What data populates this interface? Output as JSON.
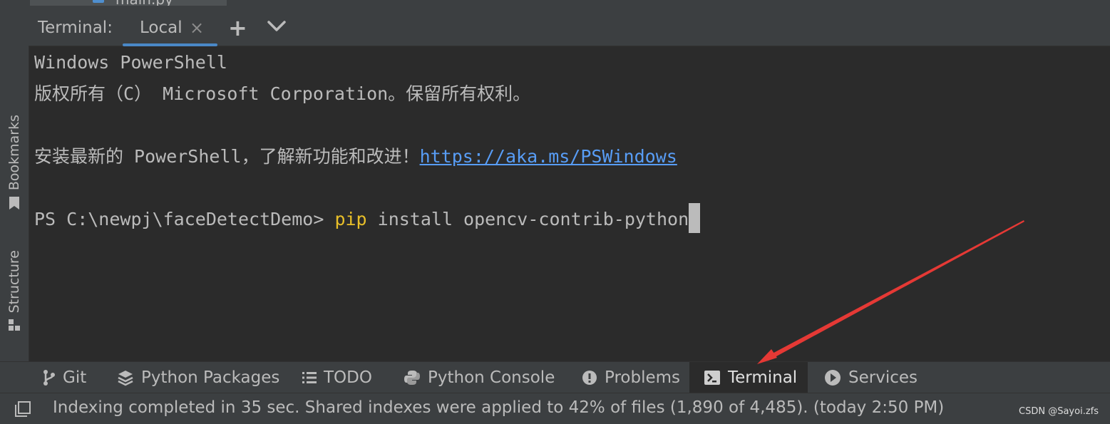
{
  "editor": {
    "file_tab": "main.py"
  },
  "side_tabs": [
    {
      "label": "Bookmarks",
      "icon": "bookmark-icon"
    },
    {
      "label": "Structure",
      "icon": "structure-icon"
    }
  ],
  "terminal": {
    "title": "Terminal:",
    "tab_label": "Local",
    "close_glyph": "×",
    "new_tab_glyph": "+",
    "lines": {
      "l1": "Windows PowerShell",
      "l2": "版权所有（C） Microsoft Corporation。保留所有权利。",
      "l3_text": "安装最新的 PowerShell，了解新功能和改进！",
      "l3_link": "https://aka.ms/PSWindows",
      "prompt": "PS C:\\newpj\\faceDetectDemo> ",
      "cmd": "pip",
      "args": " install opencv-contrib-python"
    }
  },
  "tool_windows": [
    {
      "label": "Git",
      "icon": "git-branch-icon"
    },
    {
      "label": "Python Packages",
      "icon": "layers-icon"
    },
    {
      "label": "TODO",
      "icon": "list-icon"
    },
    {
      "label": "Python Console",
      "icon": "python-icon"
    },
    {
      "label": "Problems",
      "icon": "alert-icon"
    },
    {
      "label": "Terminal",
      "icon": "terminal-icon",
      "active": true
    },
    {
      "label": "Services",
      "icon": "play-icon"
    }
  ],
  "status": {
    "message": "Indexing completed in 35 sec. Shared indexes were applied to 42% of files (1,890 of 4,485). (today 2:50 PM)",
    "watermark": "CSDN @Sayoi.zfs"
  },
  "colors": {
    "background": "#2b2b2b",
    "panel": "#3c3f41",
    "accent": "#4a88c7",
    "link": "#589df6",
    "command": "#e8bf29",
    "annotation_arrow": "#e53935"
  }
}
